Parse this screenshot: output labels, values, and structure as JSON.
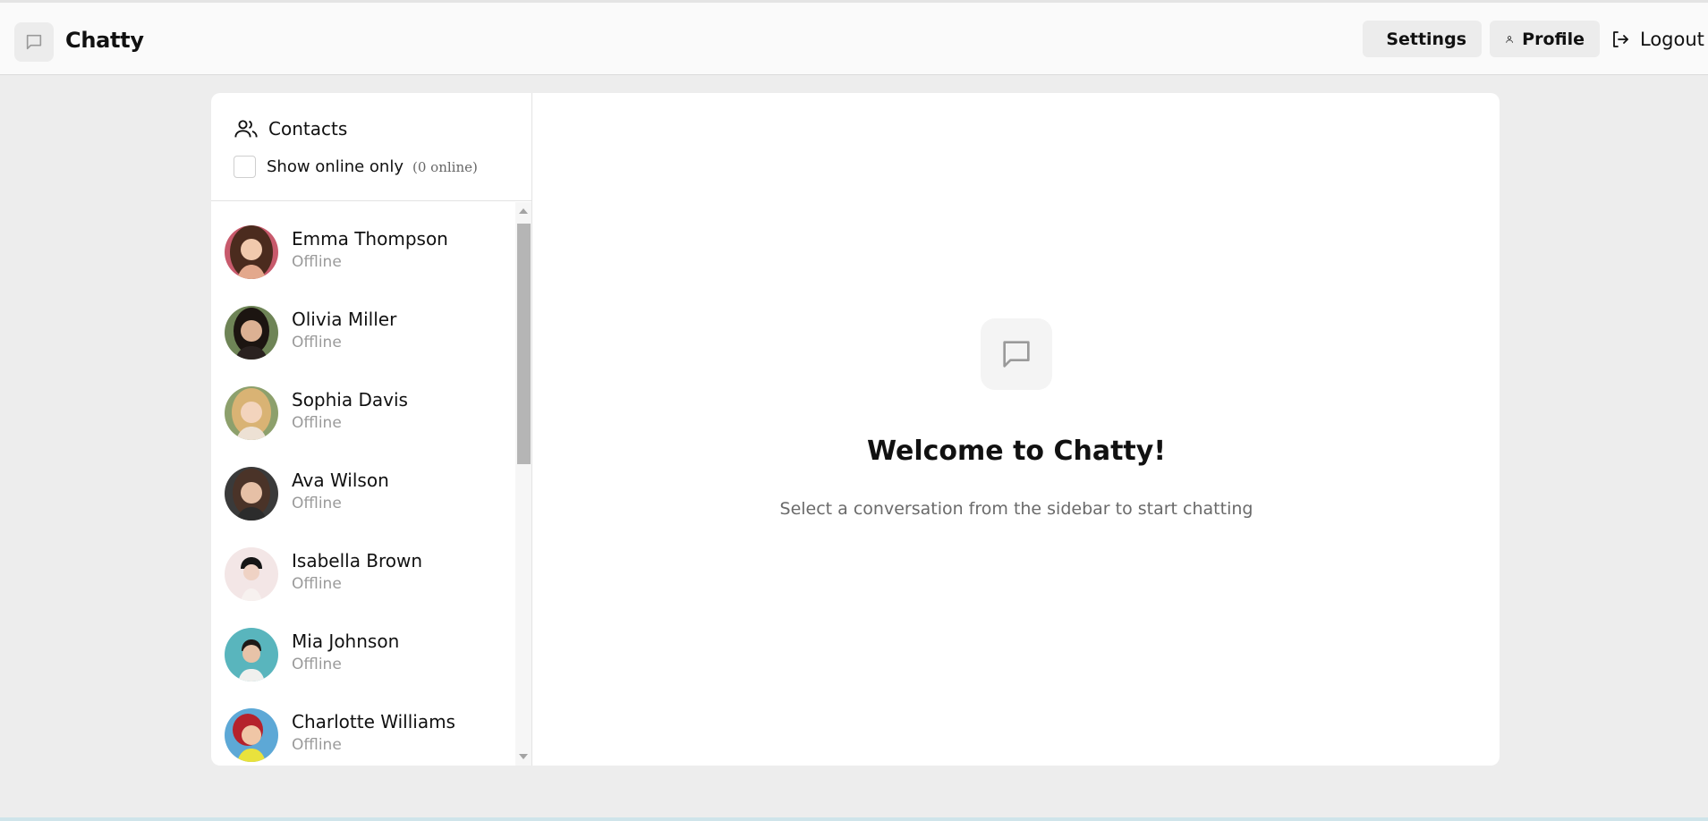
{
  "header": {
    "app_title": "Chatty",
    "settings_label": "Settings",
    "profile_label": "Profile",
    "logout_label": "Logout"
  },
  "sidebar": {
    "title": "Contacts",
    "filter_label": "Show online only",
    "online_count": "(0 online)",
    "contacts": [
      {
        "name": "Emma Thompson",
        "status": "Offline"
      },
      {
        "name": "Olivia Miller",
        "status": "Offline"
      },
      {
        "name": "Sophia Davis",
        "status": "Offline"
      },
      {
        "name": "Ava Wilson",
        "status": "Offline"
      },
      {
        "name": "Isabella Brown",
        "status": "Offline"
      },
      {
        "name": "Mia Johnson",
        "status": "Offline"
      },
      {
        "name": "Charlotte Williams",
        "status": "Offline"
      }
    ]
  },
  "main": {
    "welcome_title": "Welcome to Chatty!",
    "welcome_subtitle": "Select a conversation from the sidebar to start chatting"
  },
  "icons": {
    "logo": "message-square-icon",
    "settings": "gear-icon",
    "profile": "user-icon",
    "logout": "logout-icon",
    "contacts": "users-icon",
    "welcome": "message-square-icon"
  },
  "colors": {
    "page_background": "#ededed",
    "navbar_background": "#fafafa",
    "button_background": "#ececec",
    "muted_text": "#9a9a9a"
  }
}
